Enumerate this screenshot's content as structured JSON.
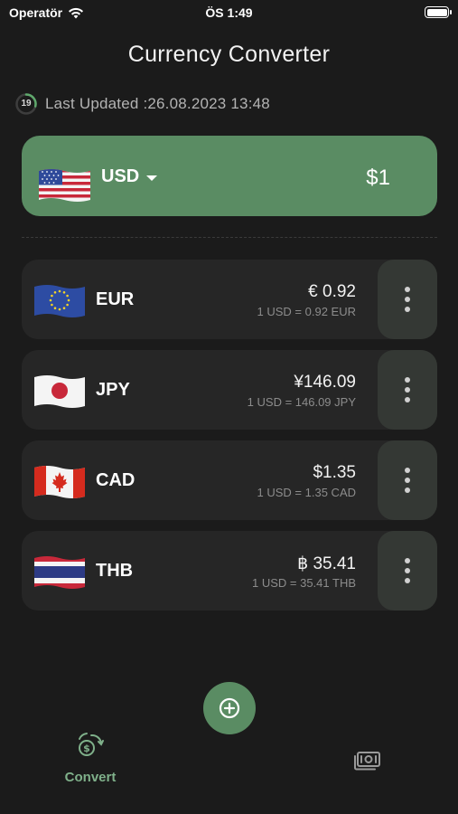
{
  "status_bar": {
    "carrier": "Operatör",
    "time": "ÖS 1:49"
  },
  "title": "Currency Converter",
  "last_updated": {
    "label": "Last Updated :26.08.2023 13:48",
    "timer_value": "19",
    "progress": 0.3
  },
  "base": {
    "code": "USD",
    "amount": "$1",
    "flag_icon": "us-flag"
  },
  "currencies": [
    {
      "code": "EUR",
      "amount": "€ 0.92",
      "rate": "1 USD = 0.92 EUR",
      "flag_icon": "eu-flag"
    },
    {
      "code": "JPY",
      "amount": "¥146.09",
      "rate": "1 USD = 146.09 JPY",
      "flag_icon": "japan-flag"
    },
    {
      "code": "CAD",
      "amount": "$1.35",
      "rate": "1 USD = 1.35 CAD",
      "flag_icon": "canada-flag"
    },
    {
      "code": "THB",
      "amount": "฿ 35.41",
      "rate": "1 USD = 35.41 THB",
      "flag_icon": "thailand-flag"
    }
  ],
  "tabs": [
    {
      "label": "Convert",
      "icon": "convert-icon",
      "active": true
    },
    {
      "label": "",
      "icon": "money-icon",
      "active": false
    }
  ],
  "colors": {
    "background": "#1b1b1b",
    "accent": "#5a8c63",
    "card": "#262626",
    "active_tab": "#7fb08a"
  }
}
